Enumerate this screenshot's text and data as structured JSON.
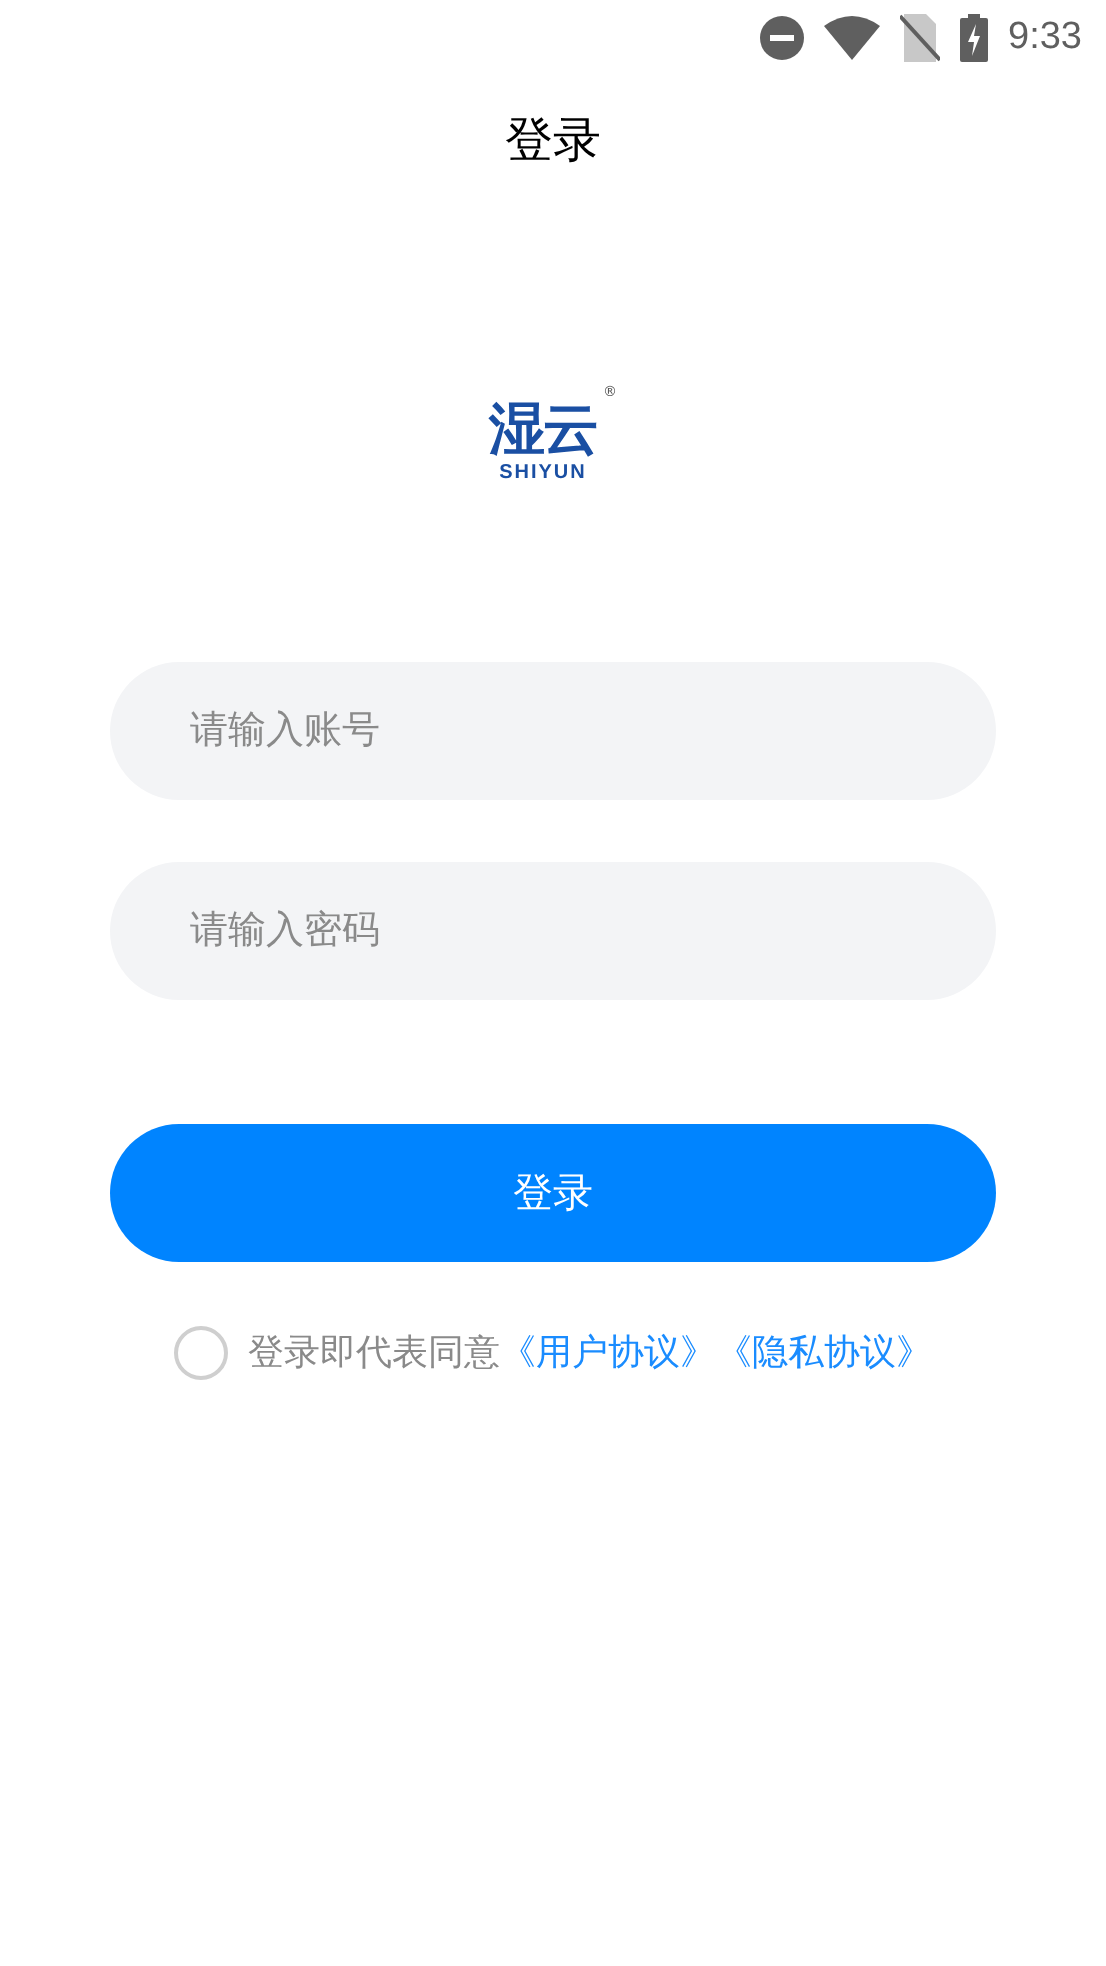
{
  "status_bar": {
    "time": "9:33"
  },
  "title": "登录",
  "logo": {
    "mark": "湿云",
    "wordmark": "SHIYUN",
    "registered": "®"
  },
  "fields": [
    {
      "placeholder": "请输入账号"
    },
    {
      "placeholder": "请输入密码"
    }
  ],
  "login_button": "登录",
  "agreement": {
    "checked": false,
    "text": "登录即代表同意",
    "links": [
      "《用户协议》",
      "《隐私协议》"
    ]
  }
}
